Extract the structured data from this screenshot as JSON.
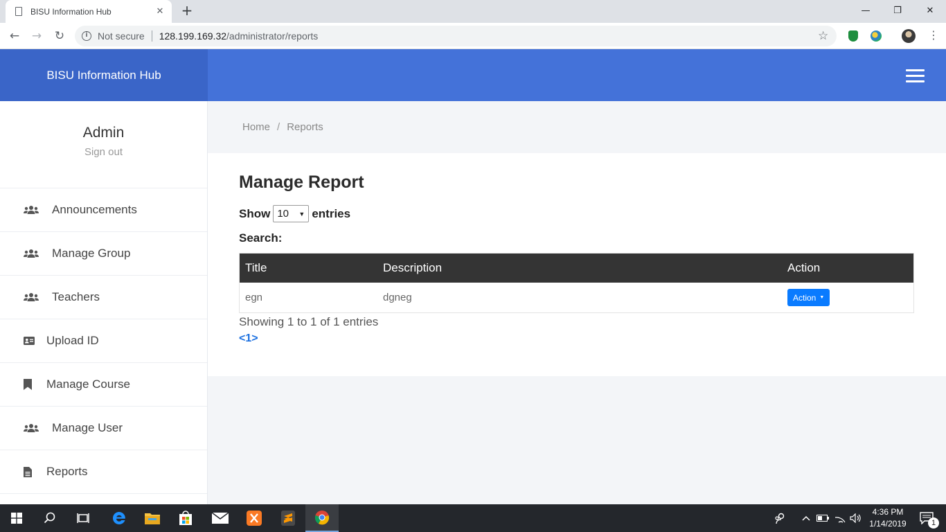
{
  "browser": {
    "tab_title": "BISU Information Hub",
    "tab_close": "✕",
    "new_tab": "+",
    "security_label": "Not secure",
    "url_host": "128.199.169.32",
    "url_path": "/administrator/reports",
    "window_controls": {
      "minimize": "—",
      "maximize": "❐",
      "close": "✕"
    }
  },
  "header": {
    "brand": "BISU Information Hub",
    "colors": {
      "brand_bg": "#3a65c8",
      "nav_bg": "#4472d9"
    }
  },
  "sidebar": {
    "user_name": "Admin",
    "sign_out": "Sign out",
    "items": [
      {
        "label": "Announcements",
        "icon": "users-icon"
      },
      {
        "label": "Manage Group",
        "icon": "users-icon"
      },
      {
        "label": "Teachers",
        "icon": "users-icon"
      },
      {
        "label": "Upload ID",
        "icon": "id-card-icon"
      },
      {
        "label": "Manage Course",
        "icon": "bookmark-icon"
      },
      {
        "label": "Manage User",
        "icon": "users-icon"
      },
      {
        "label": "Reports",
        "icon": "file-icon"
      }
    ]
  },
  "breadcrumb": {
    "home": "Home",
    "separator": "/",
    "current": "Reports"
  },
  "main": {
    "title": "Manage Report",
    "show_label": "Show",
    "entries_value": "10",
    "entries_label": "entries",
    "search_label": "Search:",
    "table": {
      "headers": [
        "Title",
        "Description",
        "Action"
      ],
      "rows": [
        {
          "title": "egn",
          "description": "dgneg",
          "action": "Action"
        }
      ]
    },
    "info": "Showing 1 to 1 of 1 entries",
    "pager": {
      "prev": "<",
      "page": "1",
      "next": ">"
    },
    "colors": {
      "table_header": "#343434",
      "action_button": "#0a7bff"
    }
  },
  "taskbar": {
    "time": "4:36 PM",
    "date": "1/14/2019",
    "notification_count": "1"
  }
}
